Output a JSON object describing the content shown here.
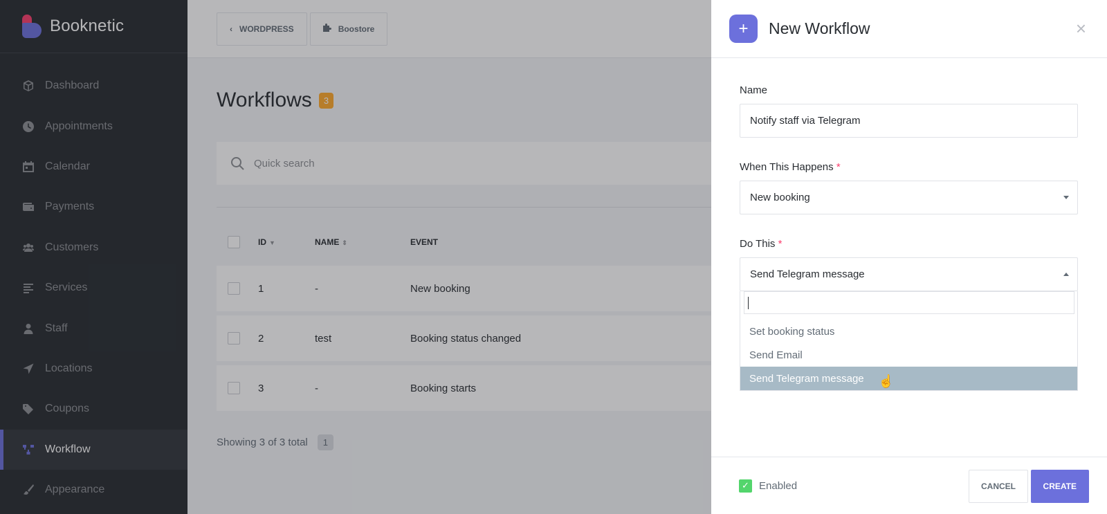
{
  "brand": {
    "name": "Booknetic"
  },
  "sidebar": {
    "items": [
      {
        "label": "Dashboard",
        "icon": "cube-icon"
      },
      {
        "label": "Appointments",
        "icon": "clock-icon"
      },
      {
        "label": "Calendar",
        "icon": "calendar-icon"
      },
      {
        "label": "Payments",
        "icon": "wallet-icon"
      },
      {
        "label": "Customers",
        "icon": "users-icon"
      },
      {
        "label": "Services",
        "icon": "list-icon"
      },
      {
        "label": "Staff",
        "icon": "user-icon"
      },
      {
        "label": "Locations",
        "icon": "location-arrow-icon"
      },
      {
        "label": "Coupons",
        "icon": "tag-icon"
      },
      {
        "label": "Workflow",
        "icon": "workflow-icon",
        "active": true
      },
      {
        "label": "Appearance",
        "icon": "brush-icon"
      }
    ]
  },
  "topbar": {
    "wordpress_label": "WORDPRESS",
    "boostore_label": "Boostore"
  },
  "main": {
    "title": "Workflows",
    "count": "3",
    "search_placeholder": "Quick search",
    "columns": {
      "id": "ID",
      "name": "NAME",
      "event": "EVENT"
    },
    "rows": [
      {
        "id": "1",
        "name": "-",
        "event": "New booking"
      },
      {
        "id": "2",
        "name": "test",
        "event": "Booking status changed"
      },
      {
        "id": "3",
        "name": "-",
        "event": "Booking starts"
      }
    ],
    "footer_text": "Showing 3 of 3 total",
    "page": "1"
  },
  "panel": {
    "title": "New Workflow",
    "close": "×",
    "name_label": "Name",
    "name_value": "Notify staff via Telegram",
    "when_label": "When This Happens",
    "when_value": "New booking",
    "do_label": "Do This",
    "do_value": "Send Telegram message",
    "required_mark": "*",
    "options": [
      "Set booking status",
      "Send Email",
      "Send Telegram message"
    ],
    "enabled_label": "Enabled",
    "cancel_label": "CANCEL",
    "create_label": "CREATE"
  },
  "colors": {
    "accent": "#6c70dc",
    "sidebar": "#292d32",
    "badge": "#ffaa2d",
    "checkbox": "#53d56c",
    "selected_option": "#a7bac6"
  }
}
